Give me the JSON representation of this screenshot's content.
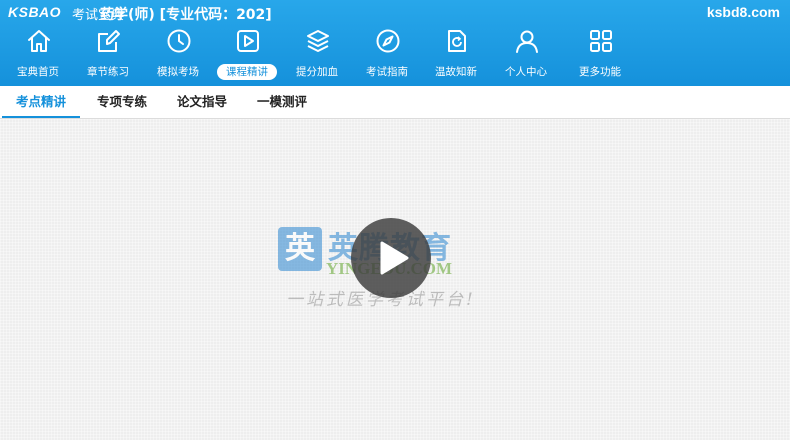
{
  "header": {
    "logo": "KSBAO",
    "logo_sub": "考试宝典",
    "title": "药学(师) [专业代码：202]",
    "site": "ksbd8.com"
  },
  "nav": {
    "items": [
      {
        "label": "宝典首页",
        "icon": "home-icon"
      },
      {
        "label": "章节练习",
        "icon": "edit-icon"
      },
      {
        "label": "模拟考场",
        "icon": "clock-icon"
      },
      {
        "label": "课程精讲",
        "icon": "video-play-icon",
        "active": true
      },
      {
        "label": "提分加血",
        "icon": "layers-icon"
      },
      {
        "label": "考试指南",
        "icon": "compass-icon"
      },
      {
        "label": "温故知新",
        "icon": "refresh-document-icon"
      },
      {
        "label": "个人中心",
        "icon": "user-icon"
      },
      {
        "label": "更多功能",
        "icon": "grid-icon"
      }
    ]
  },
  "tabs": {
    "items": [
      {
        "label": "考点精讲",
        "active": true
      },
      {
        "label": "专项专练"
      },
      {
        "label": "论文指导"
      },
      {
        "label": "一模测评"
      }
    ]
  },
  "video": {
    "watermark_box": "英",
    "watermark_cn": "英腾教育",
    "watermark_en": "YINGEDU.COM",
    "watermark_slogan": "一站式医学考试平台!"
  },
  "colors": {
    "accent": "#1591db",
    "header_top": "#28a7ea",
    "background": "#ededed"
  }
}
